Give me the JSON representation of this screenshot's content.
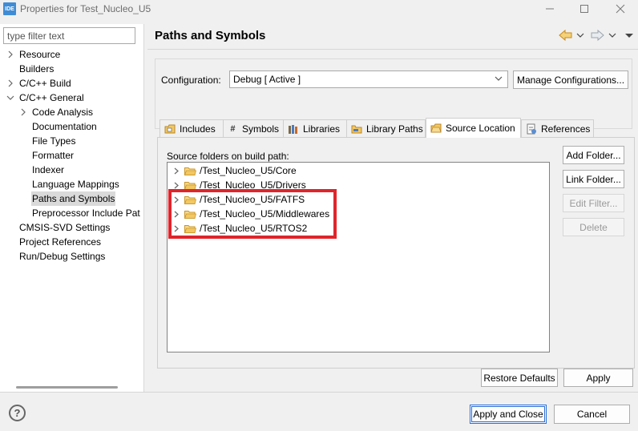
{
  "window": {
    "icon_text": "IDE",
    "title": "Properties for Test_Nucleo_U5"
  },
  "filter": {
    "placeholder": "type filter text"
  },
  "nav_tree": [
    {
      "label": "Resource",
      "level": 0,
      "expander": "collapsed"
    },
    {
      "label": "Builders",
      "level": 0,
      "expander": "none"
    },
    {
      "label": "C/C++ Build",
      "level": 0,
      "expander": "collapsed"
    },
    {
      "label": "C/C++ General",
      "level": 0,
      "expander": "expanded"
    },
    {
      "label": "Code Analysis",
      "level": 1,
      "expander": "collapsed"
    },
    {
      "label": "Documentation",
      "level": 1,
      "expander": "none"
    },
    {
      "label": "File Types",
      "level": 1,
      "expander": "none"
    },
    {
      "label": "Formatter",
      "level": 1,
      "expander": "none"
    },
    {
      "label": "Indexer",
      "level": 1,
      "expander": "none"
    },
    {
      "label": "Language Mappings",
      "level": 1,
      "expander": "none"
    },
    {
      "label": "Paths and Symbols",
      "level": 1,
      "expander": "none",
      "selected": true
    },
    {
      "label": "Preprocessor Include Pat",
      "level": 1,
      "expander": "none"
    },
    {
      "label": "CMSIS-SVD Settings",
      "level": 0,
      "expander": "none"
    },
    {
      "label": "Project References",
      "level": 0,
      "expander": "none"
    },
    {
      "label": "Run/Debug Settings",
      "level": 0,
      "expander": "none"
    }
  ],
  "page": {
    "title": "Paths and Symbols"
  },
  "config": {
    "label": "Configuration:",
    "value": "Debug  [ Active ]",
    "manage_button": "Manage Configurations..."
  },
  "tabs": [
    {
      "label": "Includes",
      "icon": "includes-icon",
      "active": false
    },
    {
      "label": "Symbols",
      "icon": "hash-icon",
      "active": false
    },
    {
      "label": "Libraries",
      "icon": "libraries-icon",
      "active": false
    },
    {
      "label": "Library Paths",
      "icon": "folder-icon",
      "active": false
    },
    {
      "label": "Source Location",
      "icon": "source-folder-icon",
      "active": true
    },
    {
      "label": "References",
      "icon": "references-icon",
      "active": false
    }
  ],
  "source": {
    "heading": "Source folders on build path:",
    "folders": [
      "/Test_Nucleo_U5/Core",
      "/Test_Nucleo_U5/Drivers",
      "/Test_Nucleo_U5/FATFS",
      "/Test_Nucleo_U5/Middlewares",
      "/Test_Nucleo_U5/RTOS2"
    ],
    "buttons": {
      "add_folder": "Add Folder...",
      "link_folder": "Link Folder...",
      "edit_filter": "Edit Filter...",
      "delete": "Delete"
    }
  },
  "page_buttons": {
    "restore_defaults": "Restore Defaults",
    "apply": "Apply"
  },
  "dialog_buttons": {
    "help": "?",
    "apply_close": "Apply and Close",
    "cancel": "Cancel"
  },
  "colors": {
    "highlight": "#e0242a",
    "folder": "#e3b341",
    "focus": "#2c6ed6"
  }
}
